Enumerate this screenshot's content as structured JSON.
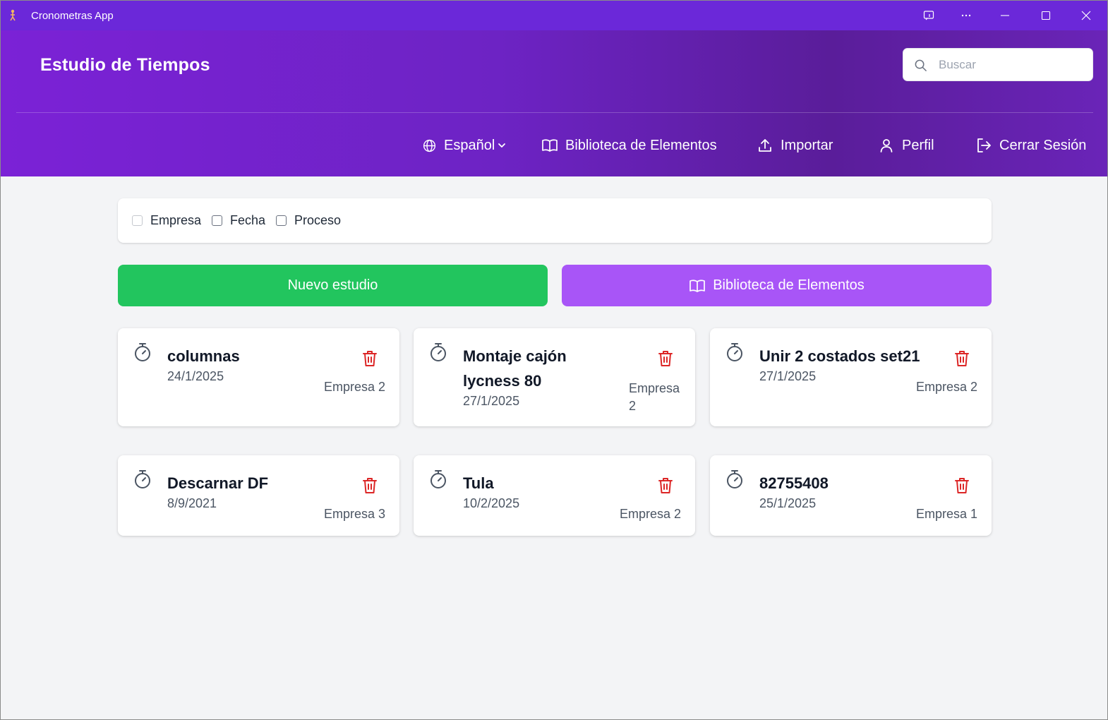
{
  "window": {
    "title": "Cronometras App",
    "icons": [
      "app-icon",
      "cast-icon",
      "more-icon",
      "minimize-icon",
      "maximize-icon",
      "close-icon"
    ]
  },
  "header": {
    "title": "Estudio de Tiempos",
    "search_placeholder": "Buscar",
    "nav": {
      "language": "Español",
      "library": "Biblioteca de Elementos",
      "import": "Importar",
      "profile": "Perfil",
      "logout": "Cerrar Sesión"
    }
  },
  "filters": [
    {
      "label": "Empresa",
      "checked": false
    },
    {
      "label": "Fecha",
      "checked": false
    },
    {
      "label": "Proceso",
      "checked": false
    }
  ],
  "actions": {
    "new_study": "Nuevo estudio",
    "library": "Biblioteca de Elementos"
  },
  "studies": [
    {
      "title": "columnas",
      "date": "24/1/2025",
      "company": "Empresa 2"
    },
    {
      "title": "Montaje cajón lycness 80",
      "date": "27/1/2025",
      "company": "Empresa 2"
    },
    {
      "title": "Unir 2 costados set21",
      "date": "27/1/2025",
      "company": "Empresa 2"
    },
    {
      "title": "Descarnar DF",
      "date": "8/9/2021",
      "company": "Empresa 3"
    },
    {
      "title": "Tula",
      "date": "10/2/2025",
      "company": "Empresa 2"
    },
    {
      "title": "82755408",
      "date": "25/1/2025",
      "company": "Empresa 1"
    }
  ],
  "colors": {
    "header_purple": "#6b28d9",
    "new_study_green": "#22c55e",
    "library_purple": "#a855f7",
    "trash_red": "#dc2626"
  }
}
